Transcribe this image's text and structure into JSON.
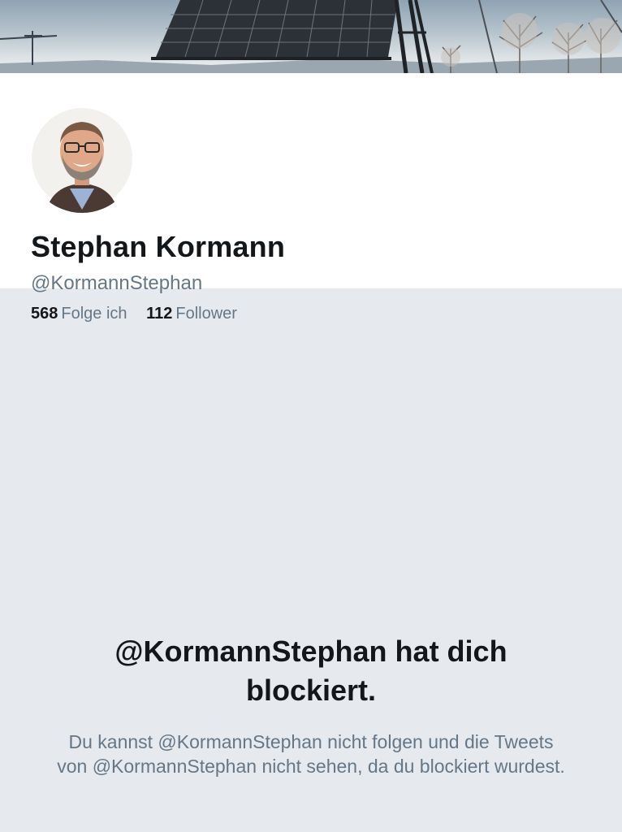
{
  "profile": {
    "display_name": "Stephan Kormann",
    "handle": "@KormannStephan",
    "following_count": "568",
    "following_label": "Folge ich",
    "followers_count": "112",
    "followers_label": "Follower"
  },
  "blocked": {
    "title": "@KormannStephan hat dich blockiert.",
    "message": "Du kannst @KormannStephan nicht folgen und die Tweets von @KormannStephan nicht sehen, da du blockiert wurdest."
  },
  "colors": {
    "text_primary": "#14171a",
    "text_secondary": "#657786",
    "background_gray": "#e6e9ee",
    "card_white": "#ffffff"
  },
  "images": {
    "banner": "solar-panel-winter-landscape-image",
    "avatar": "profile-photo"
  }
}
